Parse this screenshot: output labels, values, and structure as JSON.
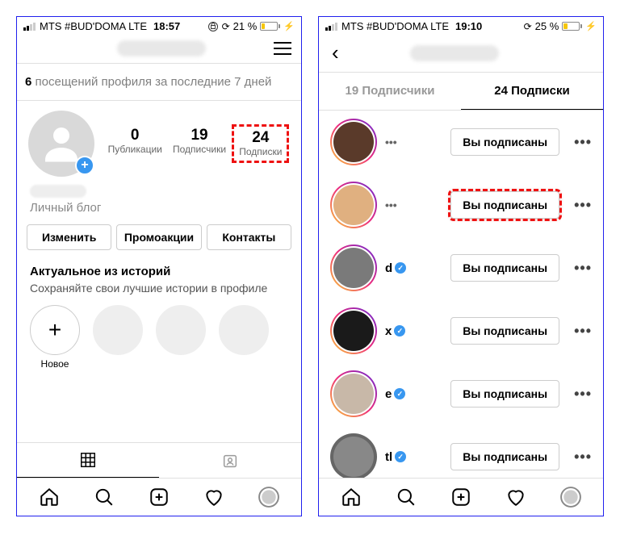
{
  "phone1": {
    "status": {
      "carrier": "MTS #BUD'DOMA  LTE",
      "time": "18:57",
      "battery_pct": "21 %"
    },
    "visits_count": "6",
    "visits_text": " посещений профиля за последние 7 дней",
    "stats": {
      "posts_num": "0",
      "posts_label": "Публикации",
      "followers_num": "19",
      "followers_label": "Подписчики",
      "following_num": "24",
      "following_label": "Подписки"
    },
    "bio_category": "Личный блог",
    "actions": {
      "edit": "Изменить",
      "promo": "Промоакции",
      "contacts": "Контакты"
    },
    "highlights_title": "Актуальное из историй",
    "highlights_sub": "Сохраняйте свои лучшие истории в профиле",
    "story_new_label": "Новое"
  },
  "phone2": {
    "status": {
      "carrier": "MTS #BUD'DOMA  LTE",
      "time": "19:10",
      "battery_pct": "25 %"
    },
    "tabs": {
      "followers": "19 Подписчики",
      "following": "24 Подписки"
    },
    "follow_button_label": "Вы подписаны",
    "items": [
      {
        "name": "",
        "verified": false,
        "ring": true,
        "avatar_bg": "#5a3a2a"
      },
      {
        "name": "",
        "verified": false,
        "ring": true,
        "avatar_bg": "#e0b080"
      },
      {
        "name": "d",
        "verified": true,
        "ring": true,
        "avatar_bg": "#7a7a7a"
      },
      {
        "name": "x",
        "verified": true,
        "ring": true,
        "avatar_bg": "#1a1a1a"
      },
      {
        "name": "e",
        "verified": true,
        "ring": true,
        "avatar_bg": "#c8b8a8"
      },
      {
        "name": "tl",
        "verified": true,
        "ring": false,
        "avatar_bg": "#888"
      }
    ]
  }
}
